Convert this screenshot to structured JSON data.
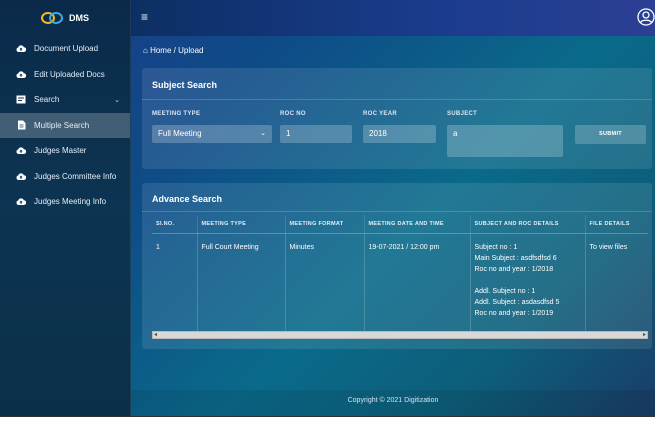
{
  "brand": {
    "name": "DMS"
  },
  "sidebar": {
    "items": [
      {
        "label": "Document Upload",
        "icon": "cloud-upload-icon",
        "active": false
      },
      {
        "label": "Edit Uploaded Docs",
        "icon": "cloud-upload-icon",
        "active": false
      },
      {
        "label": "Search",
        "icon": "search-panel-icon",
        "active": false,
        "chevron": "⌄"
      },
      {
        "label": "Multiple Search",
        "icon": "document-icon",
        "active": true
      },
      {
        "label": "Judges Master",
        "icon": "cloud-upload-icon",
        "active": false
      },
      {
        "label": "Judges Committee Info",
        "icon": "cloud-upload-icon",
        "active": false
      },
      {
        "label": "Judges Meeting Info",
        "icon": "cloud-upload-icon",
        "active": false
      }
    ]
  },
  "topbar": {
    "menu_icon": "hamburger-icon",
    "user_icon": "user-circle-icon"
  },
  "breadcrumb": {
    "home": "Home",
    "separator": "/",
    "current": "Upload"
  },
  "subject_search": {
    "title": "Subject Search",
    "meeting_type": {
      "label": "MEETING TYPE",
      "value": "Full Meeting"
    },
    "roc_no": {
      "label": "ROC NO",
      "value": "1"
    },
    "roc_year": {
      "label": "ROC YEAR",
      "value": "2018"
    },
    "subject": {
      "label": "SUBJECT",
      "value": "a"
    },
    "submit_label": "SUBMIT"
  },
  "advance_search": {
    "title": "Advance Search",
    "columns": [
      "SI.NO.",
      "MEETING TYPE",
      "MEETING FORMAT",
      "MEETING DATE AND TIME",
      "SUBJECT AND ROC DETAILS",
      "FILE DETAILS"
    ],
    "rows": [
      {
        "sino": "1",
        "meeting_type": "Full Court Meeting",
        "meeting_format": "Minutes",
        "date_time": "19-07-2021 / 12:00 pm",
        "details": [
          "Subject no : 1",
          "Main Subject : asdfsdfsd 6",
          "Roc no and year : 1/2018",
          "",
          "Addl. Subject no : 1",
          "Addl. Subject : asdasdfsd 5",
          "Roc no and year : 1/2019"
        ],
        "file_details": "To view files"
      }
    ]
  },
  "footer": {
    "text": "Copyright © 2021 Digitization"
  },
  "colors": {
    "active_item": "#3b5a80",
    "accent": "#1b3c8e"
  }
}
